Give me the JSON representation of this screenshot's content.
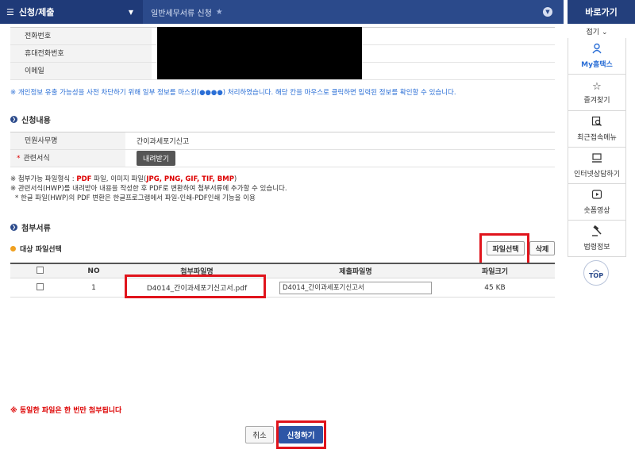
{
  "topbar": {
    "menu_title": "신청/제출",
    "breadcrumb": "일반세무서류 신청",
    "quick_title": "바로가기"
  },
  "sidebar": {
    "fold_label": "접기",
    "items": [
      {
        "label": "My홈택스",
        "icon": "person-icon"
      },
      {
        "label": "즐겨찾기",
        "icon": "star-icon"
      },
      {
        "label": "최근접속메뉴",
        "icon": "recent-search-icon"
      },
      {
        "label": "인터넷상담하기",
        "icon": "computer-icon"
      },
      {
        "label": "숏폼영상",
        "icon": "play-icon"
      },
      {
        "label": "법령정보",
        "icon": "gavel-icon"
      }
    ],
    "top_label": "TOP"
  },
  "contact": {
    "phone_label": "전화번호",
    "mobile_label": "휴대전화번호",
    "email_label": "이메일"
  },
  "privacy_notice": "※ 개인정보 유출 가능성을 사전 차단하기 위해 일부 정보를 마스킹(●●●●) 처리하였습니다. 해당 칸을 마우스로 클릭하면 입력된 정보를 확인할 수 있습니다.",
  "apply_section": {
    "title": "신청내용",
    "civil_label": "민원사무명",
    "civil_value": "간이과세포기신고",
    "form_label": "관련서식",
    "download_label": "내려받기"
  },
  "notes": {
    "line1_prefix": "※ 첨부가능 파일형식 : ",
    "line1_pdf": "PDF",
    "line1_mid": " 파일, 이미지 파일(",
    "line1_img": "JPG, PNG, GIF, TIF, BMP",
    "line1_suffix": ")",
    "line2": "※ 관련서식(HWP)를 내려받아 내용을 작성한 후 PDF로 변환하여 첨부서류에 추가할 수 있습니다.",
    "line3": "* 한글 파일(HWP)의 PDF 변환은 한글프로그램에서 파일-인쇄-PDF인쇄 기능을 이용"
  },
  "attach_section": {
    "title": "첨부서류",
    "target_label": "대상 파일선택",
    "select_file_label": "파일선택",
    "delete_label": "삭제"
  },
  "file_table": {
    "headers": [
      "NO",
      "첨부파일명",
      "제출파일명",
      "파일크기"
    ],
    "rows": [
      {
        "no": "1",
        "attach_name": "D4014_간이과세포기신고서.pdf",
        "submit_name": "D4014_간이과세포기신고서",
        "size": "45 KB"
      }
    ]
  },
  "warning": "※ 동일한 파일은 한 번만 첨부됩니다",
  "actions": {
    "cancel_label": "취소",
    "submit_label": "신청하기"
  },
  "colors": {
    "topbar": "#2b4a8b",
    "accent_blue": "#2e56a6",
    "highlight_red": "#e0141c",
    "notice_blue": "#2b6fd6"
  }
}
